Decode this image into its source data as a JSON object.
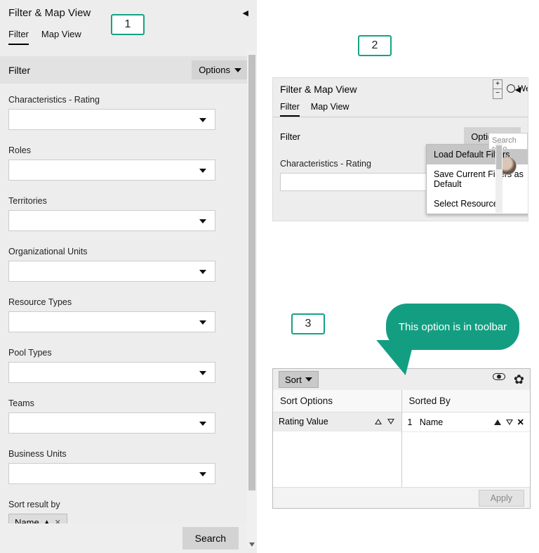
{
  "badges": {
    "b1": "1",
    "b2": "2",
    "b3": "3"
  },
  "panel1": {
    "title": "Filter & Map View",
    "tabs": [
      "Filter",
      "Map View"
    ],
    "active_tab": 0,
    "filter_section_label": "Filter",
    "options_label": "Options",
    "fields": [
      "Characteristics - Rating",
      "Roles",
      "Territories",
      "Organizational Units",
      "Resource Types",
      "Pool Types",
      "Teams",
      "Business Units"
    ],
    "sort_label": "Sort result by",
    "sort_chip": "Name",
    "search_label": "Search"
  },
  "panel2": {
    "title": "Filter & Map View",
    "tabs": [
      "Filter",
      "Map View"
    ],
    "active_tab": 0,
    "filter_section_label": "Filter",
    "options_label": "Options",
    "menu": [
      "Load Default Filters",
      "Save Current Filters as Default",
      "Select Resources"
    ],
    "highlight_index": 0,
    "first_field": "Characteristics - Rating",
    "right_label": "We",
    "search_placeholder": "Search reso"
  },
  "callout_text": "This option is in toolbar",
  "panel3": {
    "sort_button": "Sort",
    "left_head": "Sort Options",
    "right_head": "Sorted By",
    "left_row": "Rating Value",
    "right_index": "1",
    "right_row": "Name",
    "apply_label": "Apply"
  }
}
